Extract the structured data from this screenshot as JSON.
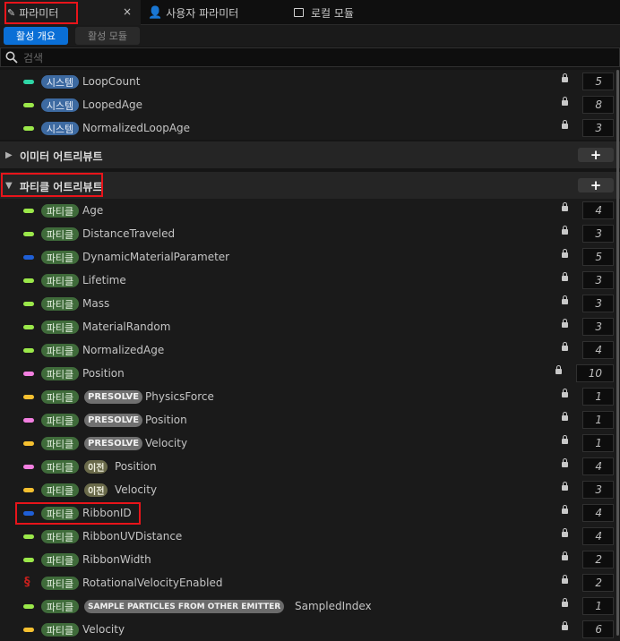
{
  "tabs": [
    {
      "label": "파라미터",
      "close": "×"
    },
    {
      "label": "사용자 파라미터"
    },
    {
      "label": "로컬 모듈"
    }
  ],
  "toggle": {
    "active_overview": "활성 개요",
    "active_modules": "활성 모듈"
  },
  "search": {
    "placeholder": "검색"
  },
  "system_rows": [
    {
      "badge": "시스템",
      "name": "LoopCount",
      "value": "5",
      "color": "#2fd6a6"
    },
    {
      "badge": "시스템",
      "name": "LoopedAge",
      "value": "8",
      "color": "#9be84a"
    },
    {
      "badge": "시스템",
      "name": "NormalizedLoopAge",
      "value": "3",
      "color": "#9be84a"
    }
  ],
  "sections": {
    "emitter": {
      "title": "이미터 어트리뷰트",
      "add": "+"
    },
    "particle": {
      "title": "파티클 어트리뷰트",
      "add": "+"
    }
  },
  "particle_rows": [
    {
      "badge": "파티클",
      "tag": "",
      "name": "Age",
      "value": "4",
      "color": "#9be84a"
    },
    {
      "badge": "파티클",
      "tag": "",
      "name": "DistanceTraveled",
      "value": "3",
      "color": "#9be84a"
    },
    {
      "badge": "파티클",
      "tag": "",
      "name": "DynamicMaterialParameter",
      "value": "5",
      "color": "#1f5fd6"
    },
    {
      "badge": "파티클",
      "tag": "",
      "name": "Lifetime",
      "value": "3",
      "color": "#9be84a"
    },
    {
      "badge": "파티클",
      "tag": "",
      "name": "Mass",
      "value": "3",
      "color": "#9be84a"
    },
    {
      "badge": "파티클",
      "tag": "",
      "name": "MaterialRandom",
      "value": "3",
      "color": "#9be84a"
    },
    {
      "badge": "파티클",
      "tag": "",
      "name": "NormalizedAge",
      "value": "4",
      "color": "#9be84a"
    },
    {
      "badge": "파티클",
      "tag": "",
      "name": "Position",
      "value": "10",
      "color": "#f27fe0"
    },
    {
      "badge": "파티클",
      "tag": "PRESOLVE",
      "name": "PhysicsForce",
      "value": "1",
      "color": "#f5c030"
    },
    {
      "badge": "파티클",
      "tag": "PRESOLVE",
      "name": "Position",
      "value": "1",
      "color": "#f27fe0"
    },
    {
      "badge": "파티클",
      "tag": "PRESOLVE",
      "name": "Velocity",
      "value": "1",
      "color": "#f5c030"
    },
    {
      "badge": "파티클",
      "tag": "이전",
      "name": "Position",
      "value": "4",
      "color": "#f27fe0"
    },
    {
      "badge": "파티클",
      "tag": "이전",
      "name": "Velocity",
      "value": "3",
      "color": "#f5c030"
    },
    {
      "badge": "파티클",
      "tag": "",
      "name": "RibbonID",
      "value": "4",
      "color": "#1f5fd6"
    },
    {
      "badge": "파티클",
      "tag": "",
      "name": "RibbonUVDistance",
      "value": "4",
      "color": "#9be84a"
    },
    {
      "badge": "파티클",
      "tag": "",
      "name": "RibbonWidth",
      "value": "2",
      "color": "#9be84a"
    },
    {
      "badge": "파티클",
      "tag": "",
      "name": "RotationalVelocityEnabled",
      "value": "2",
      "color": "#c8201d",
      "icon": "§"
    },
    {
      "badge": "파티클",
      "tag": "SAMPLE PARTICLES FROM OTHER EMITTER",
      "name": "SampledIndex",
      "value": "1",
      "color": "#9be84a"
    },
    {
      "badge": "파티클",
      "tag": "",
      "name": "Velocity",
      "value": "6",
      "color": "#f5c030"
    }
  ]
}
